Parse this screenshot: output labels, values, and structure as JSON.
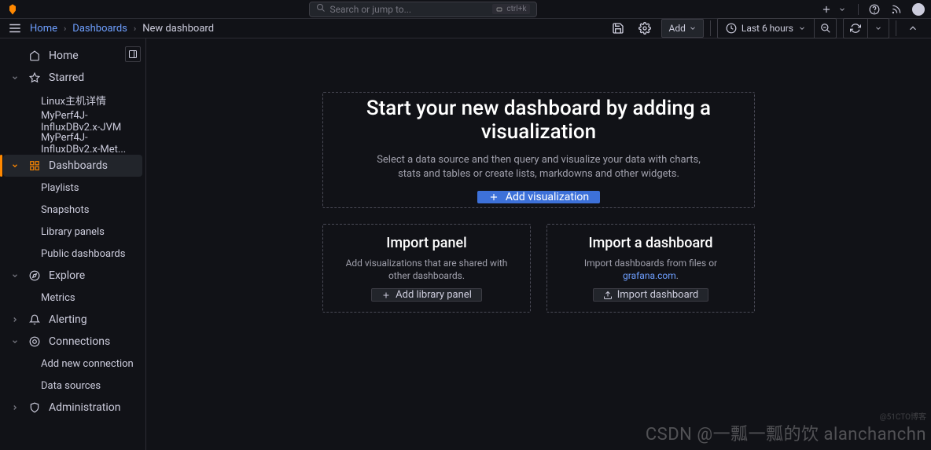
{
  "topbar": {
    "search_placeholder": "Search or jump to...",
    "shortcut": "ctrl+k"
  },
  "breadcrumbs": {
    "home": "Home",
    "dashboards": "Dashboards",
    "current": "New dashboard"
  },
  "toolbar": {
    "add_label": "Add",
    "time_label": "Last 6 hours"
  },
  "sidebar": {
    "home": "Home",
    "starred": "Starred",
    "starred_items": [
      "Linux主机详情",
      "MyPerf4J-InfluxDBv2.x-JVM",
      "MyPerf4J-InfluxDBv2.x-Met..."
    ],
    "dashboards": "Dashboards",
    "dashboards_items": [
      "Playlists",
      "Snapshots",
      "Library panels",
      "Public dashboards"
    ],
    "explore": "Explore",
    "explore_items": [
      "Metrics"
    ],
    "alerting": "Alerting",
    "connections": "Connections",
    "connections_items": [
      "Add new connection",
      "Data sources"
    ],
    "administration": "Administration"
  },
  "main": {
    "big_title": "Start your new dashboard by adding a visualization",
    "big_desc": "Select a data source and then query and visualize your data with charts, stats and tables or create lists, markdowns and other widgets.",
    "add_viz_label": "Add visualization",
    "import_panel_title": "Import panel",
    "import_panel_desc": "Add visualizations that are shared with other dashboards.",
    "add_library_label": "Add library panel",
    "import_dash_title": "Import a dashboard",
    "import_dash_desc_prefix": "Import dashboards from files or ",
    "import_dash_link": "grafana.com",
    "import_dash_label": "Import dashboard"
  },
  "watermark": "CSDN @一瓢一瓢的饮 alanchanchn",
  "watermark2": "@51CTO博客"
}
